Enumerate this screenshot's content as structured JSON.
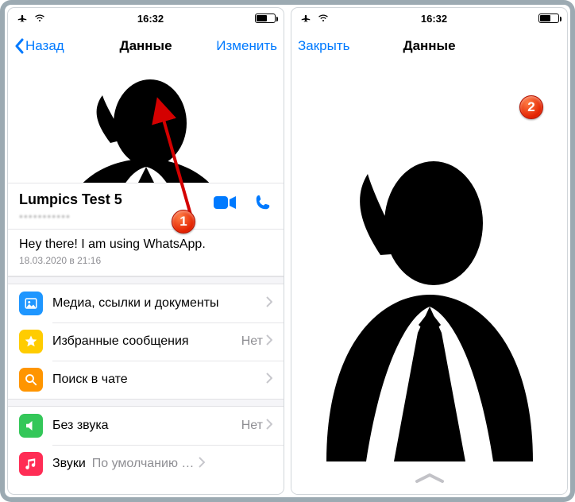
{
  "statusbar": {
    "time": "16:32"
  },
  "left": {
    "nav": {
      "back": "Назад",
      "title": "Данные",
      "edit": "Изменить"
    },
    "contact": {
      "name": "Lumpics Test 5"
    },
    "status": {
      "text": "Hey there! I am using WhatsApp.",
      "date": "18.03.2020 в 21:16"
    },
    "rows": {
      "media": {
        "label": "Медиа, ссылки и документы"
      },
      "starred": {
        "label": "Избранные сообщения",
        "value": "Нет"
      },
      "search": {
        "label": "Поиск в чате"
      },
      "mute": {
        "label": "Без звука",
        "value": "Нет"
      },
      "sounds": {
        "label": "Звуки",
        "value": "По умолчанию (Нот…"
      }
    },
    "badge": "1"
  },
  "right": {
    "nav": {
      "close": "Закрыть",
      "title": "Данные"
    },
    "badge": "2"
  }
}
